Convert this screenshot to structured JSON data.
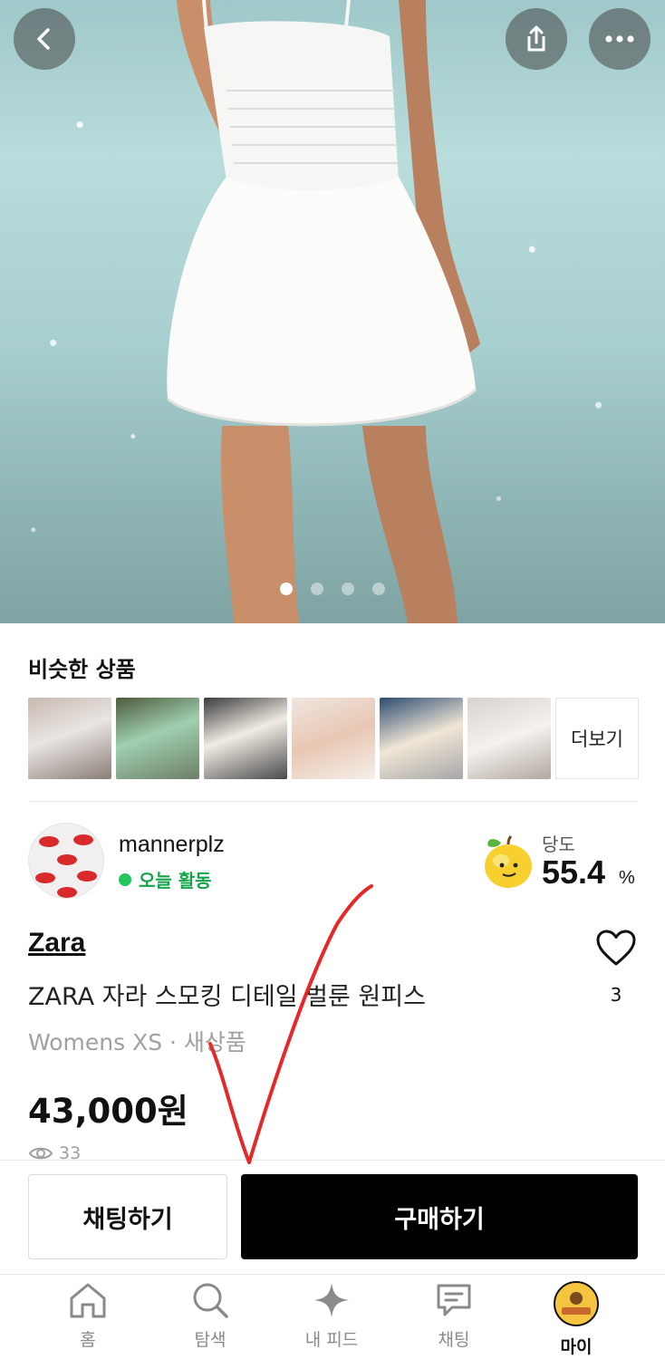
{
  "header": {
    "back_icon": "chevron-left-icon",
    "share_icon": "share-icon",
    "more_icon": "more-horizontal-icon"
  },
  "gallery": {
    "page_count": 4,
    "active_page": 1
  },
  "similar": {
    "title": "비슷한 상품",
    "more_label": "더보기",
    "thumbnail_count": 6
  },
  "seller": {
    "name": "mannerplz",
    "status": "오늘 활동",
    "status_color": "#22c55e",
    "sweetness_label": "당도",
    "sweetness_value": "55.4",
    "sweetness_unit": "%"
  },
  "product": {
    "brand": "Zara",
    "title": "ZARA 자라 스모킹 디테일 벌룬 원피스",
    "meta": "Womens XS · 새상품",
    "price": "43,000원",
    "views": "33",
    "likes": "3"
  },
  "actions": {
    "chat_label": "채팅하기",
    "buy_label": "구매하기"
  },
  "tabs": [
    {
      "label": "홈",
      "icon": "home-icon"
    },
    {
      "label": "탐색",
      "icon": "search-icon"
    },
    {
      "label": "내 피드",
      "icon": "sparkle-icon"
    },
    {
      "label": "채팅",
      "icon": "chat-icon"
    },
    {
      "label": "마이",
      "icon": "profile-avatar"
    }
  ]
}
